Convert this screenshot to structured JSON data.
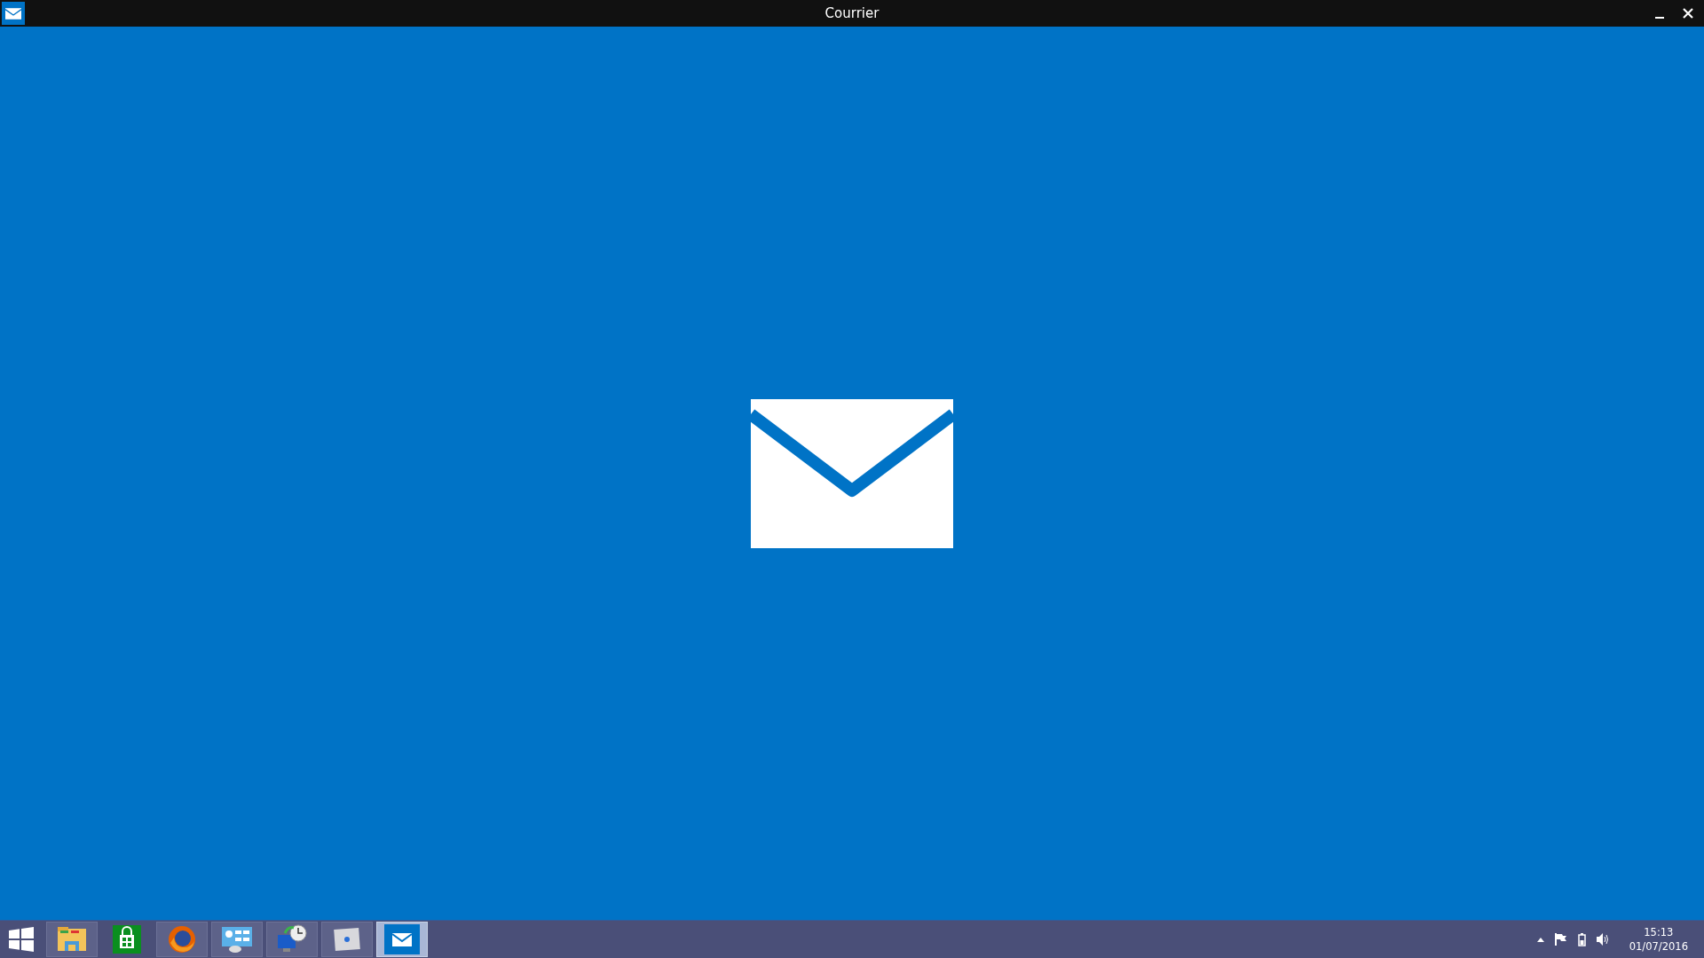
{
  "window": {
    "title": "Courrier"
  },
  "taskbar": {
    "apps": [
      {
        "kind": "explorer",
        "running": true,
        "selected": false
      },
      {
        "kind": "store",
        "running": false,
        "selected": false
      },
      {
        "kind": "firefox",
        "running": true,
        "selected": false
      },
      {
        "kind": "control",
        "running": true,
        "selected": false
      },
      {
        "kind": "sync",
        "running": true,
        "selected": false
      },
      {
        "kind": "photo",
        "running": true,
        "selected": false
      },
      {
        "kind": "mail",
        "running": true,
        "selected": true
      }
    ],
    "clock": {
      "time": "15:13",
      "date": "01/07/2016"
    }
  }
}
